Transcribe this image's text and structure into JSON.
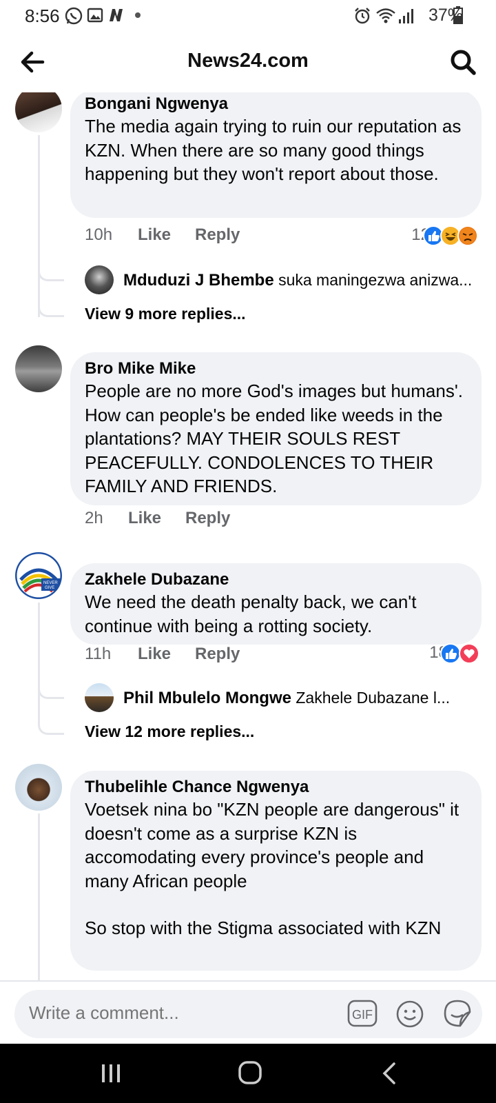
{
  "status_bar": {
    "time": "8:56",
    "battery": "37%"
  },
  "header": {
    "title": "News24.com"
  },
  "comments": [
    {
      "author": "Bongani Ngwenya",
      "text": "The media again trying to ruin our reputation as KZN. When there are so many good things happening but they won't report about those.",
      "time": "10h",
      "like": "Like",
      "reply": "Reply",
      "reactions": {
        "count": "12",
        "types": [
          "like",
          "haha",
          "angry"
        ]
      },
      "top_reply": {
        "author": "Mduduzi J Bhembe",
        "text": "suka maningezwa anizwa..."
      },
      "view_more": "View 9 more replies..."
    },
    {
      "author": "Bro Mike Mike",
      "text": "People are no more God's images but humans'. How can people's be ended like weeds in the plantations? MAY THEIR SOULS REST PEACEFULLY. CONDOLENCES TO THEIR FAMILY AND FRIENDS.",
      "time": "2h",
      "like": "Like",
      "reply": "Reply"
    },
    {
      "author": "Zakhele Dubazane",
      "text": "We need the death penalty back, we can't continue with being a rotting society.",
      "time": "11h",
      "like": "Like",
      "reply": "Reply",
      "reactions": {
        "count": "18",
        "types": [
          "like",
          "love"
        ]
      },
      "top_reply": {
        "author": "Phil Mbulelo Mongwe",
        "text": "Zakhele Dubazane l..."
      },
      "view_more": "View 12 more replies..."
    },
    {
      "author": "Thubelihle Chance Ngwenya",
      "text": "Voetsek nina bo \"KZN people are dangerous\" it doesn't come as a surprise KZN is accomodating every province's people and many African people",
      "text2": "So stop with the Stigma associated with KZN"
    }
  ],
  "composer": {
    "placeholder": "Write a comment...",
    "gif_label": "GIF"
  },
  "colors": {
    "accent": "#1877f2",
    "love": "#f33e58",
    "bubble": "#f0f2f5",
    "secondary_text": "#65676b"
  }
}
